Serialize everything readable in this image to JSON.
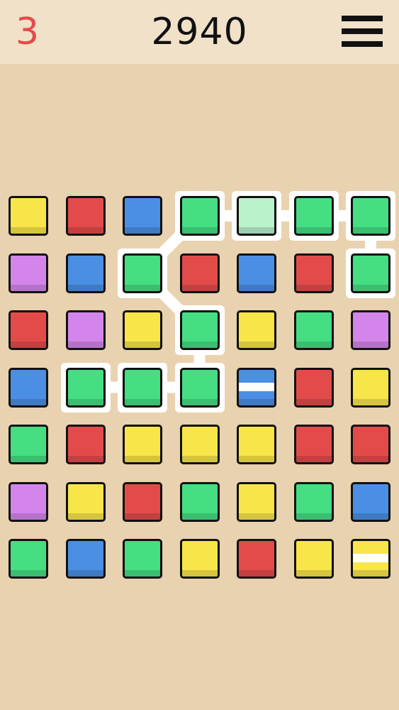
{
  "header": {
    "moves_left": "3",
    "score": "2940",
    "menu_icon": "hamburger-menu-icon"
  },
  "colors": {
    "yellow": "#f8e54a",
    "red": "#e34b4b",
    "blue": "#4a8fe3",
    "green": "#45de82",
    "purple": "#d485ec",
    "pale-green": "#b9f2cd",
    "moves_text": "#e34b4b",
    "background": "#e9d2b0",
    "topbar": "#f1e1c8",
    "selection": "#ffffff"
  },
  "board": {
    "rows": [
      [
        {
          "c": "yellow"
        },
        {
          "c": "red"
        },
        {
          "c": "blue"
        },
        {
          "c": "green"
        },
        {
          "c": "pale-green"
        },
        {
          "c": "green"
        },
        {
          "c": "green"
        }
      ],
      [
        {
          "c": "purple"
        },
        {
          "c": "blue"
        },
        {
          "c": "green"
        },
        {
          "c": "red"
        },
        {
          "c": "blue"
        },
        {
          "c": "red"
        },
        {
          "c": "green"
        }
      ],
      [
        {
          "c": "red"
        },
        {
          "c": "purple"
        },
        {
          "c": "yellow"
        },
        {
          "c": "green"
        },
        {
          "c": "yellow"
        },
        {
          "c": "green"
        },
        {
          "c": "purple"
        }
      ],
      [
        {
          "c": "blue"
        },
        {
          "c": "green"
        },
        {
          "c": "green"
        },
        {
          "c": "green"
        },
        {
          "c": "blue",
          "special": "stripe"
        },
        {
          "c": "red"
        },
        {
          "c": "yellow"
        }
      ],
      [
        {
          "c": "green"
        },
        {
          "c": "red"
        },
        {
          "c": "yellow"
        },
        {
          "c": "yellow"
        },
        {
          "c": "yellow"
        },
        {
          "c": "red"
        },
        {
          "c": "red"
        }
      ],
      [
        {
          "c": "purple"
        },
        {
          "c": "yellow"
        },
        {
          "c": "red"
        },
        {
          "c": "green"
        },
        {
          "c": "yellow"
        },
        {
          "c": "green"
        },
        {
          "c": "blue"
        }
      ],
      [
        {
          "c": "green"
        },
        {
          "c": "blue"
        },
        {
          "c": "green"
        },
        {
          "c": "yellow"
        },
        {
          "c": "red"
        },
        {
          "c": "yellow"
        },
        {
          "c": "yellow",
          "special": "stripe"
        }
      ]
    ],
    "selected_path": [
      [
        3,
        1
      ],
      [
        3,
        2
      ],
      [
        3,
        3
      ],
      [
        2,
        3
      ],
      [
        1,
        2
      ],
      [
        0,
        3
      ],
      [
        0,
        4
      ],
      [
        0,
        5
      ],
      [
        0,
        6
      ],
      [
        1,
        6
      ]
    ]
  }
}
